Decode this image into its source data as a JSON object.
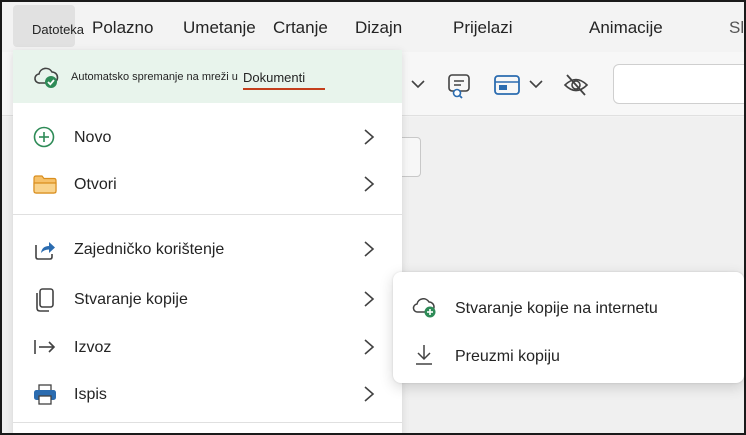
{
  "ribbon": {
    "tabs": [
      {
        "label": "Datoteka"
      },
      {
        "label": "Polazno"
      },
      {
        "label": "Umetanje"
      },
      {
        "label": "Crtanje"
      },
      {
        "label": "Dizajn"
      },
      {
        "label": "Prijelazi"
      },
      {
        "label": "Animacije"
      },
      {
        "label": "Sl"
      }
    ]
  },
  "file_menu": {
    "autosave": {
      "text": "Automatsko spremanje na mreži u",
      "location": "Dokumenti",
      "icon": "cloud-check-icon"
    },
    "items": [
      {
        "label": "Novo",
        "icon": "plus-circle-icon"
      },
      {
        "label": "Otvori",
        "icon": "folder-icon"
      },
      {
        "label": "Zajedničko korištenje",
        "icon": "share-icon"
      },
      {
        "label": "Stvaranje kopije",
        "icon": "copy-icon"
      },
      {
        "label": "Izvoz",
        "icon": "export-arrow-icon"
      },
      {
        "label": "Ispis",
        "icon": "printer-icon"
      }
    ]
  },
  "submenu": {
    "items": [
      {
        "label": "Stvaranje kopije na internetu",
        "icon": "cloud-add-icon"
      },
      {
        "label": "Preuzmi kopiju",
        "icon": "download-icon"
      }
    ]
  },
  "colors": {
    "autosave_bg": "#e8f4ec",
    "accent_underline": "#c43e1c",
    "new_icon": "#2e8b57",
    "folder_icon": "#e8a33d",
    "share_icon": "#2b6cb0",
    "printer_icon": "#2b6cb0"
  }
}
